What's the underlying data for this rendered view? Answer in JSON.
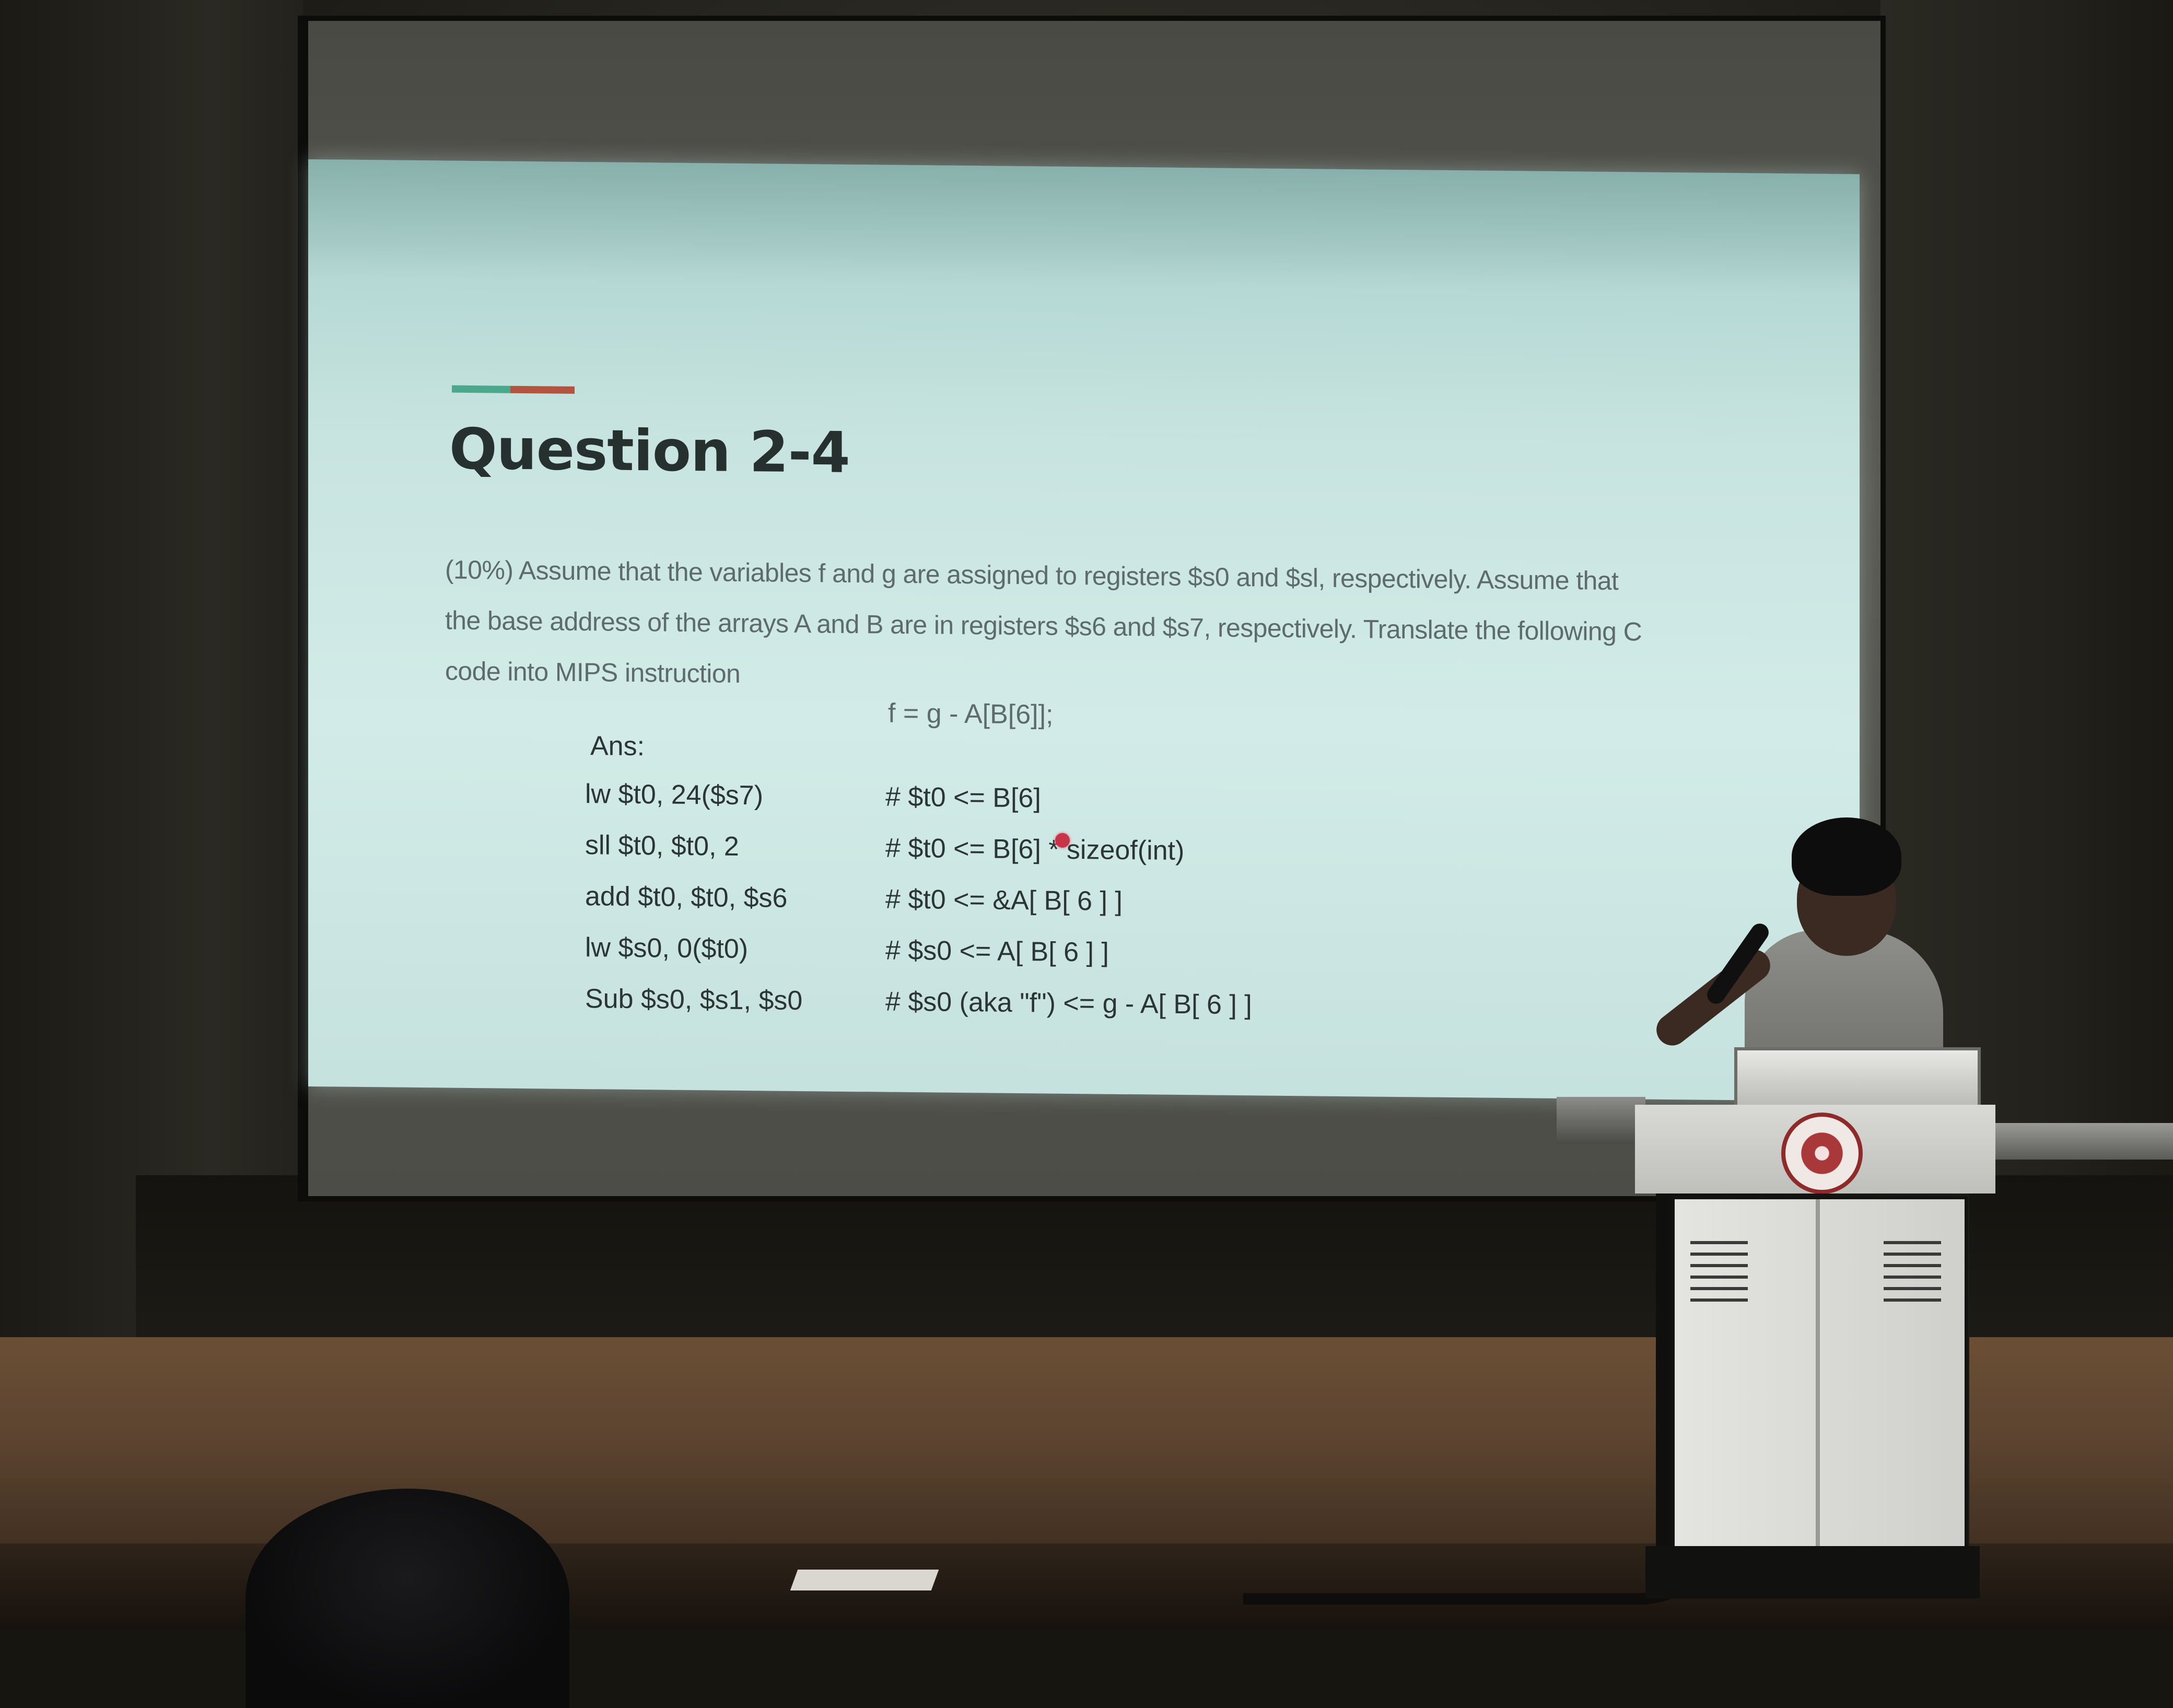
{
  "slide": {
    "title": "Question 2-4",
    "question_lines": [
      "(10%) Assume that the variables f and g are assigned to registers $s0 and $sl, respectively. Assume that",
      "the base address of the arrays A and B are in registers $s6 and $s7, respectively. Translate the following C",
      "code into MIPS instruction"
    ],
    "c_code": "f = g - A[B[6]];",
    "answer_label": "Ans:",
    "code": [
      {
        "instr": "lw $t0, 24($s7)",
        "comment": "# $t0 <= B[6]"
      },
      {
        "instr": "sll $t0, $t0, 2",
        "comment": "# $t0 <= B[6] * sizeof(int)"
      },
      {
        "instr": "add $t0, $t0, $s6",
        "comment": "# $t0 <= &A[ B[ 6 ] ]"
      },
      {
        "instr": "lw $s0, 0($t0)",
        "comment": "# $s0 <= A[ B[ 6 ] ]"
      },
      {
        "instr": "Sub $s0, $s1, $s0",
        "comment": "# $s0 (aka \"f\") <= g - A[ B[ 6 ] ]"
      }
    ],
    "accent_colors": [
      "#4aa98a",
      "#b2543f"
    ]
  }
}
